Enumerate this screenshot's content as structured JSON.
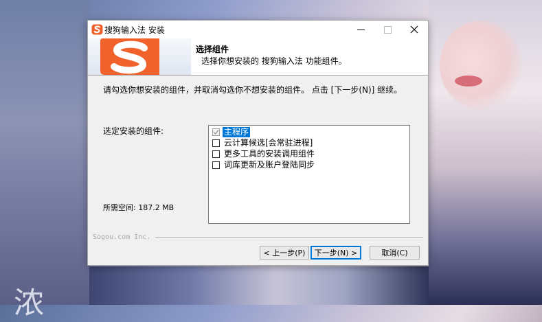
{
  "window": {
    "title": "搜狗输入法 安装",
    "icon": "sogou-logo-icon",
    "controls": [
      "minimize-icon",
      "maximize-icon",
      "close-icon"
    ]
  },
  "header": {
    "title": "选择组件",
    "subtitle": "选择你想安装的 搜狗输入法 功能组件。",
    "banner_logo": "sogou-s-logo"
  },
  "body": {
    "instruction": "请勾选你想安装的组件，并取消勾选你不想安装的组件。 点击 [下一步(N)] 继续。",
    "select_label": "选定安装的组件:",
    "space_label": "所需空间: 187.2 MB",
    "components": [
      {
        "label": "主程序",
        "checked": true,
        "disabled": true,
        "selected": true
      },
      {
        "label": "云计算候选[会常驻进程]",
        "checked": false,
        "disabled": false,
        "selected": false
      },
      {
        "label": "更多工具的安装调用组件",
        "checked": false,
        "disabled": false,
        "selected": false
      },
      {
        "label": "词库更新及账户登陆同步",
        "checked": false,
        "disabled": false,
        "selected": false
      }
    ]
  },
  "footer": {
    "brand": "Sogou.com Inc.",
    "back_label": "< 上一步(P)",
    "next_label": "下一步(N) >",
    "cancel_label": "取消(C)"
  },
  "colors": {
    "accent": "#0078d7",
    "brand_orange": "#f0612b",
    "dialog_bg": "#f0f0f0"
  },
  "desktop": {
    "overlay_char": "浓"
  }
}
